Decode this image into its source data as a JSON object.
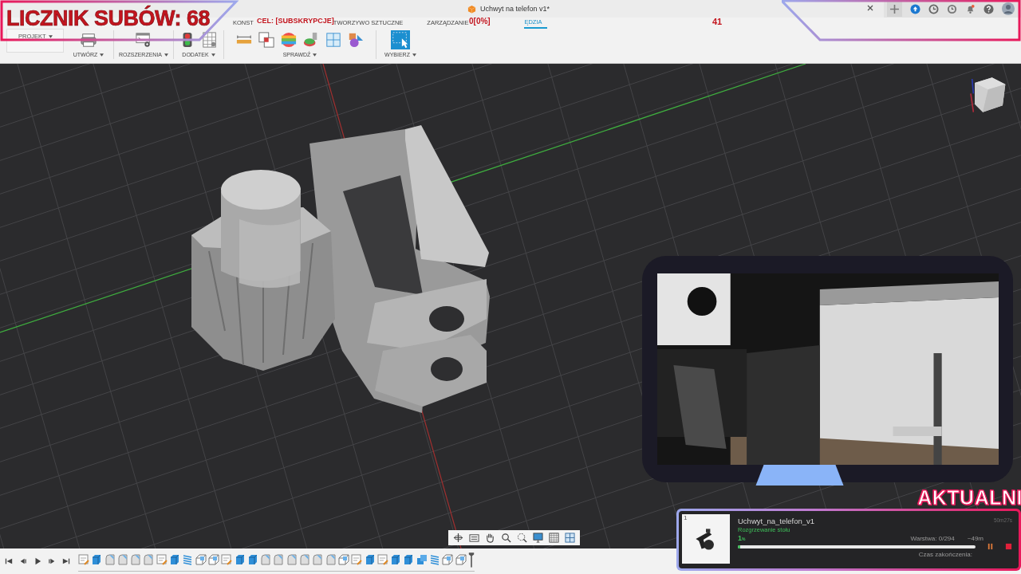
{
  "overlay": {
    "sub_counter": "LICZNIK SUBÓW: 68",
    "goal": "CEL: [SUBSKRYPCJE]",
    "goal_progress": "0[0%]",
    "goal_count": "41",
    "banner": "AKTUALNI"
  },
  "document_tab": {
    "title": "Uchwyt na telefon v1*"
  },
  "tabs": [
    {
      "label": "KONST",
      "selected": false
    },
    {
      "label": "TWORZYWO SZTUCZNE",
      "selected": false
    },
    {
      "label": "ZARZĄDZANIE",
      "selected": false
    },
    {
      "label": "ĘDZIA",
      "selected": true
    }
  ],
  "ribbon": {
    "project": "PROJEKT",
    "groups": [
      {
        "label": "UTWÓRZ"
      },
      {
        "label": "ROZSZERZENIA"
      },
      {
        "label": "DODATEK"
      },
      {
        "label": "SPRAWDŹ"
      },
      {
        "label": "WYBIERZ"
      }
    ]
  },
  "print_job": {
    "index": "1",
    "name": "Uchwyt_na_telefon_v1",
    "status": "Rozgrzewanie stołu",
    "percent": "1",
    "percent_unit": "%",
    "level": 0.01,
    "layer": "Warstwa: 0/294",
    "remaining": "~49m",
    "elapsed": "50m27s",
    "finish_label": "Czas zakończenia:"
  },
  "timeline": {
    "features": [
      {
        "kind": "sketch"
      },
      {
        "kind": "extrude"
      },
      {
        "kind": "fillet"
      },
      {
        "kind": "fillet"
      },
      {
        "kind": "fillet"
      },
      {
        "kind": "fillet"
      },
      {
        "kind": "sketch"
      },
      {
        "kind": "extrude"
      },
      {
        "kind": "thread"
      },
      {
        "kind": "box"
      },
      {
        "kind": "box"
      },
      {
        "kind": "sketch"
      },
      {
        "kind": "extrude"
      },
      {
        "kind": "extrude"
      },
      {
        "kind": "fillet"
      },
      {
        "kind": "fillet"
      },
      {
        "kind": "fillet"
      },
      {
        "kind": "fillet"
      },
      {
        "kind": "fillet"
      },
      {
        "kind": "fillet"
      },
      {
        "kind": "box"
      },
      {
        "kind": "sketch"
      },
      {
        "kind": "extrude"
      },
      {
        "kind": "sketch"
      },
      {
        "kind": "extrude"
      },
      {
        "kind": "extrude"
      },
      {
        "kind": "combine"
      },
      {
        "kind": "thread"
      },
      {
        "kind": "box"
      },
      {
        "kind": "box"
      }
    ]
  }
}
